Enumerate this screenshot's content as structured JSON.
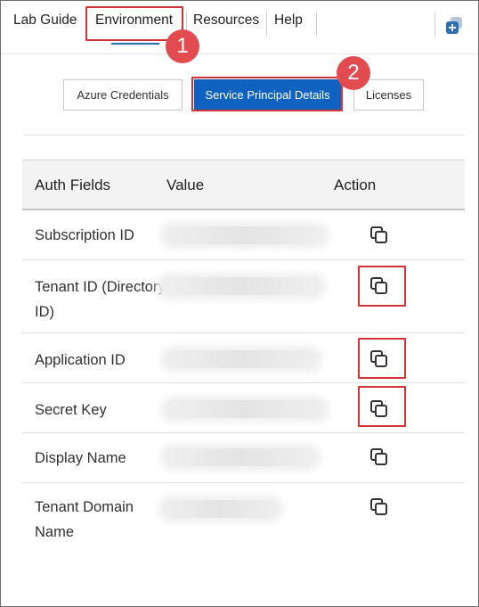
{
  "nav": {
    "tabs": [
      {
        "label": "Lab Guide"
      },
      {
        "label": "Environment"
      },
      {
        "label": "Resources"
      },
      {
        "label": "Help"
      }
    ],
    "active": "Environment"
  },
  "callouts": [
    "1",
    "2"
  ],
  "subtabs": [
    {
      "label": "Azure Credentials"
    },
    {
      "label": "Service Principal Details"
    },
    {
      "label": "Licenses"
    }
  ],
  "table": {
    "headers": [
      "Auth Fields",
      "Value",
      "Action"
    ],
    "rows": [
      {
        "field": "Subscription ID"
      },
      {
        "field": "Tenant ID (Directory ID)"
      },
      {
        "field": "Application ID"
      },
      {
        "field": "Secret Key"
      },
      {
        "field": "Display Name"
      },
      {
        "field": "Tenant Domain Name"
      }
    ]
  },
  "colors": {
    "accent": "#0f62c0",
    "highlight": "#d13438",
    "marker": "#e24b4f"
  },
  "icons": [
    "copy-icon",
    "app-launcher-icon"
  ]
}
